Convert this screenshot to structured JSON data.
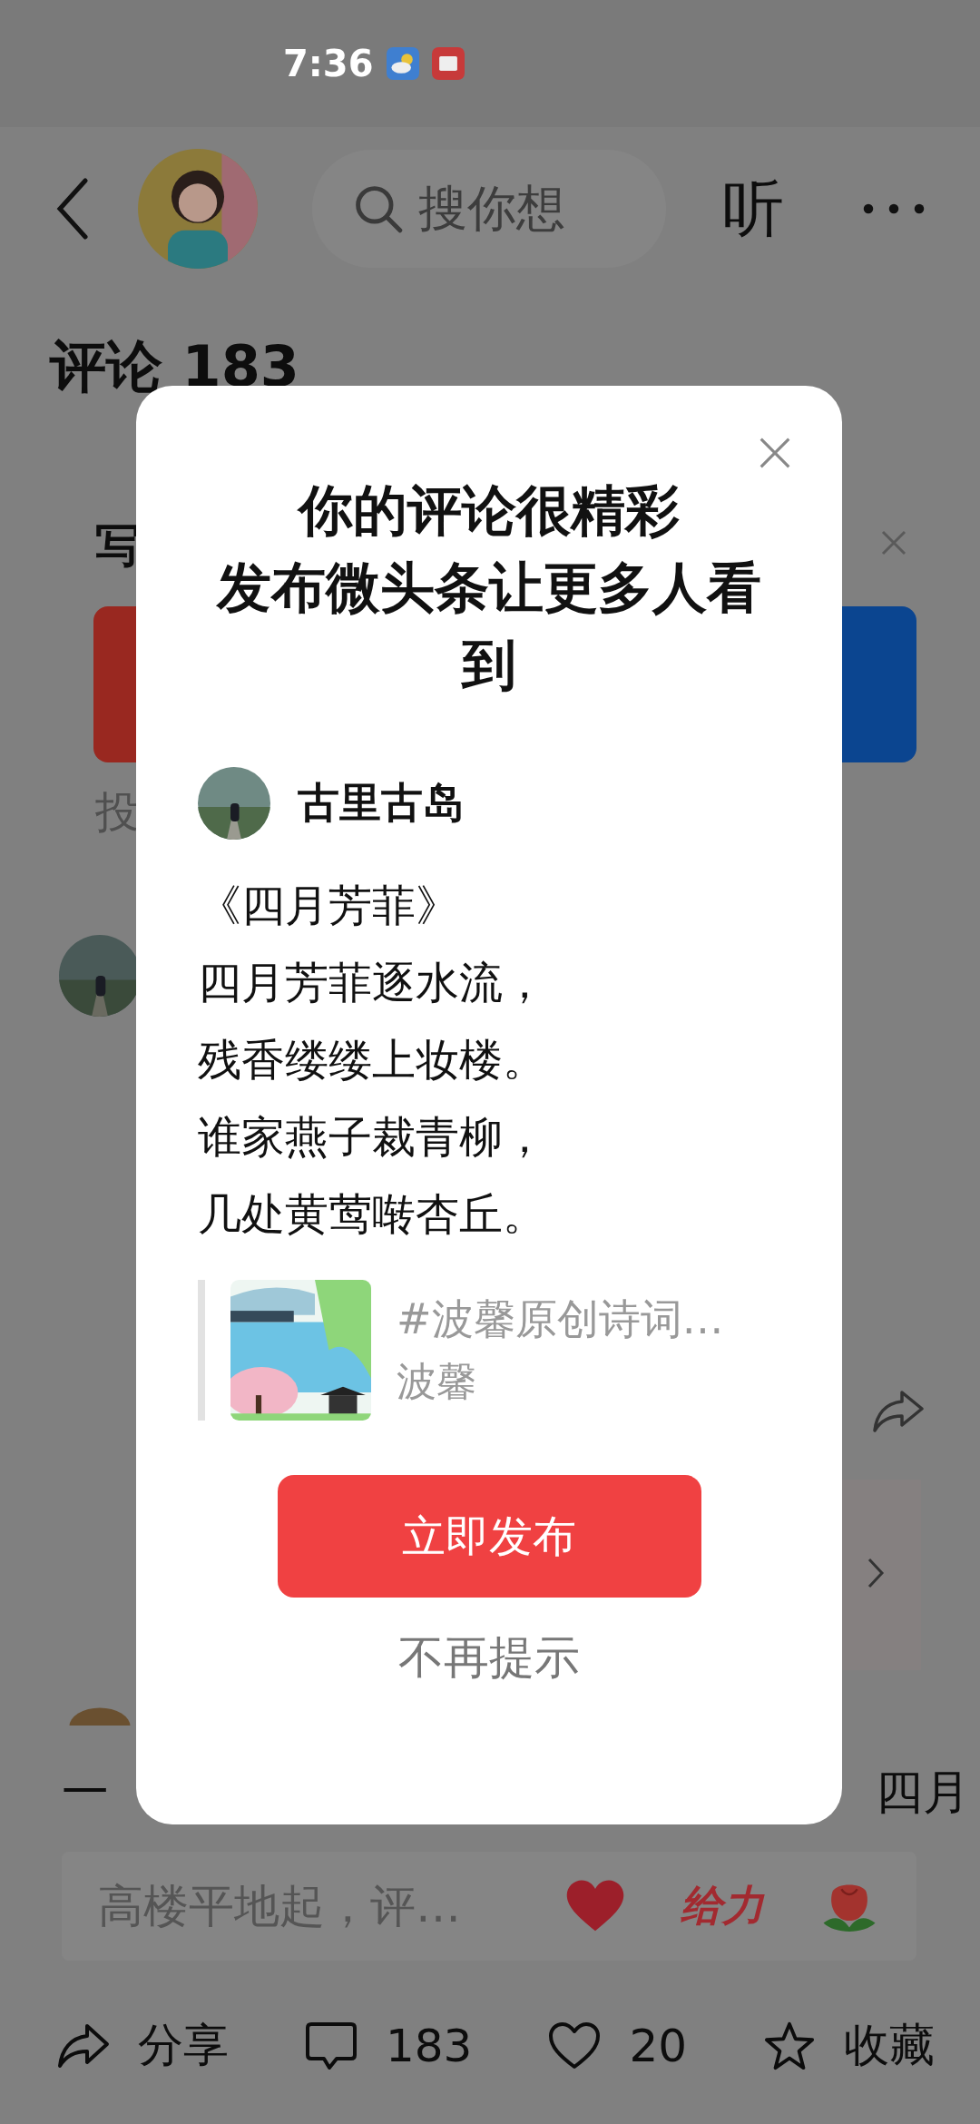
{
  "status_bar": {
    "time": "7:36"
  },
  "header": {
    "search": {
      "placeholder": "搜你想"
    },
    "listen": "听"
  },
  "comments": {
    "title": "评论 183"
  },
  "behind": {
    "write_label": "写",
    "submit_label": "投",
    "line_start": "一",
    "line_end": "四月"
  },
  "comment_input": {
    "placeholder": "高楼平地起，评…",
    "sticker": "给力"
  },
  "action_bar": [
    {
      "kind": "share",
      "label": "分享"
    },
    {
      "kind": "comment",
      "label": "183"
    },
    {
      "kind": "like",
      "label": "20"
    },
    {
      "kind": "favorite",
      "label": "收藏"
    }
  ],
  "dialog": {
    "title_lines": [
      "你的评论很精彩",
      "发布微头条让更多人看到"
    ],
    "author": "古里古岛",
    "poem_lines": [
      "《四月芳菲》",
      "四月芳菲逐水流，",
      "残香缕缕上妆楼。",
      "谁家燕子裁青柳，",
      "几处黄莺啭杏丘。"
    ],
    "topic": {
      "title": "#波馨原创诗词…",
      "author": "波馨"
    },
    "primary_button": "立即发布",
    "secondary_button": "不再提示"
  }
}
